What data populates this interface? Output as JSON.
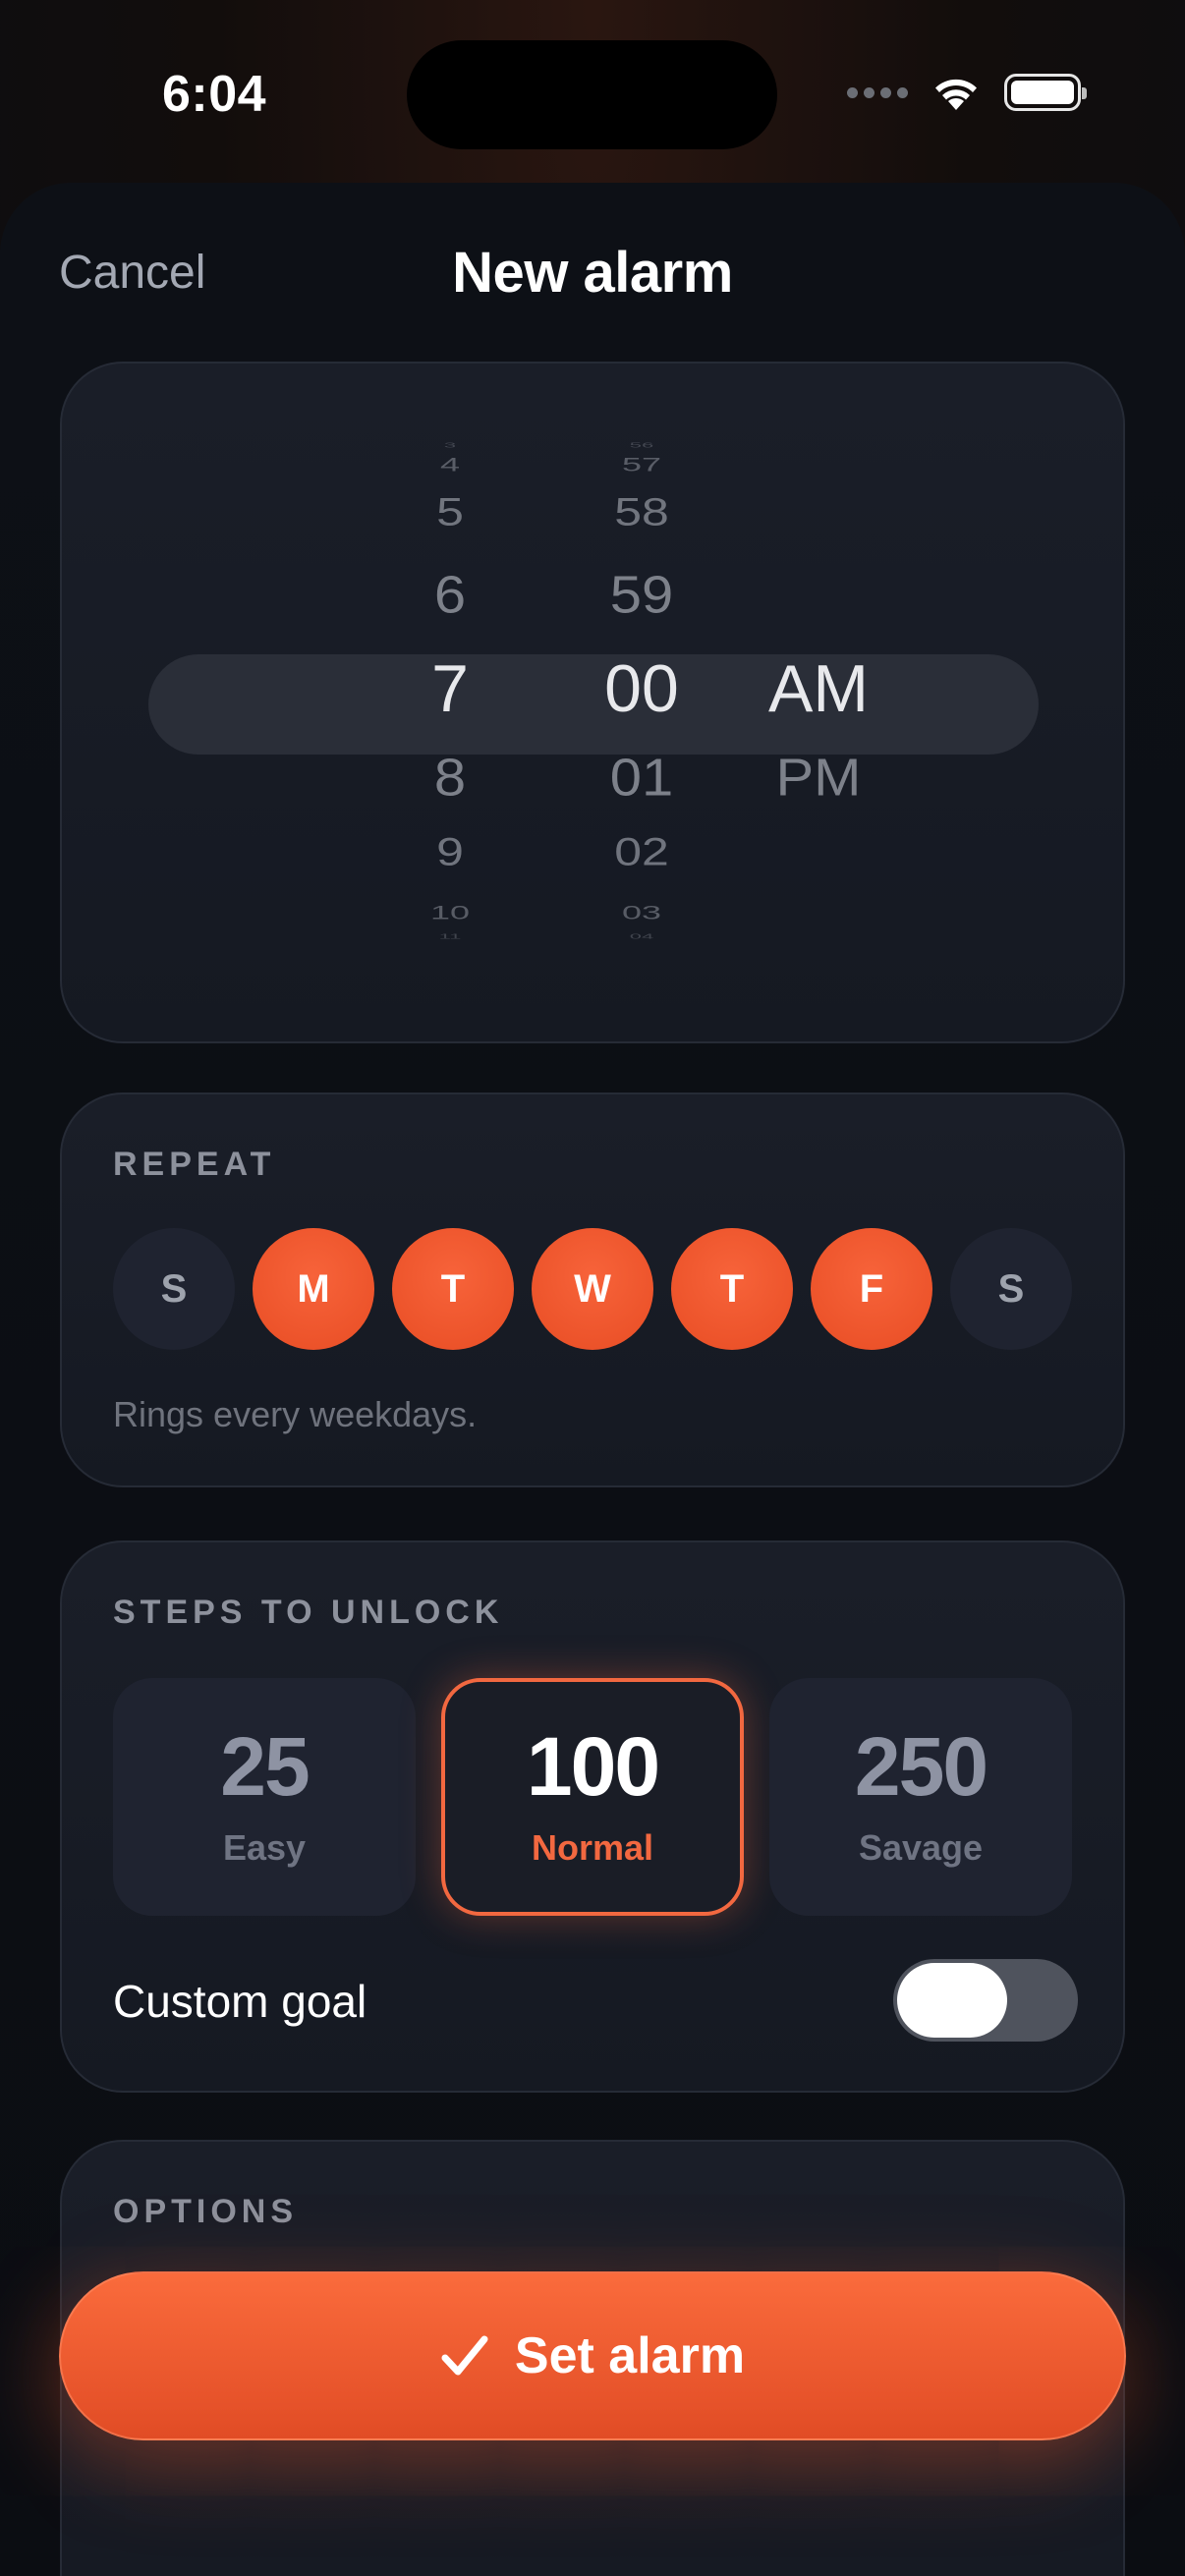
{
  "status_bar": {
    "time": "6:04"
  },
  "header": {
    "cancel_label": "Cancel",
    "title": "New alarm"
  },
  "picker": {
    "hours": [
      "3",
      "4",
      "5",
      "6",
      "7",
      "8",
      "9",
      "10",
      "11"
    ],
    "minutes": [
      "56",
      "57",
      "58",
      "59",
      "00",
      "01",
      "02",
      "03",
      "04"
    ],
    "periods": [
      "AM",
      "PM"
    ],
    "selected_hour": "7",
    "selected_minute": "00",
    "selected_period": "AM"
  },
  "repeat": {
    "label": "REPEAT",
    "days": [
      {
        "letter": "S",
        "active": false
      },
      {
        "letter": "M",
        "active": true
      },
      {
        "letter": "T",
        "active": true
      },
      {
        "letter": "W",
        "active": true
      },
      {
        "letter": "T",
        "active": true
      },
      {
        "letter": "F",
        "active": true
      },
      {
        "letter": "S",
        "active": false
      }
    ],
    "note": "Rings every weekdays."
  },
  "steps": {
    "label": "STEPS TO UNLOCK",
    "options": [
      {
        "value": "25",
        "name": "Easy",
        "selected": false
      },
      {
        "value": "100",
        "name": "Normal",
        "selected": true
      },
      {
        "value": "250",
        "name": "Savage",
        "selected": false
      }
    ],
    "custom_goal_label": "Custom goal",
    "custom_goal_enabled": false
  },
  "options": {
    "label": "OPTIONS"
  },
  "cta": {
    "label": "Set alarm"
  },
  "colors": {
    "accent": "#f26840",
    "card_bg": "#1a1e28",
    "background": "#0b0d12"
  }
}
